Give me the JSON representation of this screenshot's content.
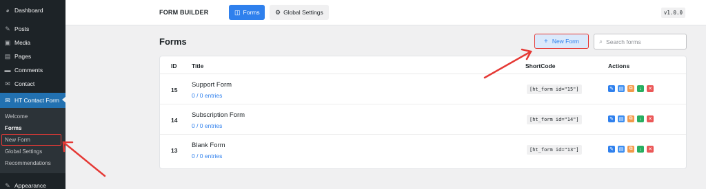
{
  "sidebar": {
    "items": [
      {
        "label": "Dashboard",
        "icon": "dashboard-icon"
      },
      {
        "label": "Posts",
        "icon": "pin-icon"
      },
      {
        "label": "Media",
        "icon": "media-icon"
      },
      {
        "label": "Pages",
        "icon": "pages-icon"
      },
      {
        "label": "Comments",
        "icon": "comment-icon"
      },
      {
        "label": "Contact",
        "icon": "mail-icon"
      },
      {
        "label": "HT Contact Form",
        "icon": "envelope-icon"
      }
    ],
    "submenu": [
      "Welcome",
      "Forms",
      "New Form",
      "Global Settings",
      "Recommendations"
    ],
    "appearance": "Appearance"
  },
  "topbar": {
    "brand": "FORM BUILDER",
    "tab_forms": "Forms",
    "tab_settings": "Global Settings",
    "version": "v1.0.0"
  },
  "page": {
    "title": "Forms",
    "new_button": "New Form",
    "search_placeholder": "Search forms"
  },
  "table": {
    "headers": {
      "id": "ID",
      "title": "Title",
      "shortcode": "ShortCode",
      "actions": "Actions"
    },
    "rows": [
      {
        "id": "15",
        "title": "Support Form",
        "entries": "0 / 0 entries",
        "shortcode": "[ht_form id=\"15\"]"
      },
      {
        "id": "14",
        "title": "Subscription Form",
        "entries": "0 / 0 entries",
        "shortcode": "[ht_form id=\"14\"]"
      },
      {
        "id": "13",
        "title": "Blank Form",
        "entries": "0 / 0 entries",
        "shortcode": "[ht_form id=\"13\"]"
      }
    ]
  },
  "colors": {
    "accent": "#2f80ed",
    "wp_sidebar": "#1d2327",
    "wp_active": "#2271b1",
    "annotation": "#e53935"
  }
}
